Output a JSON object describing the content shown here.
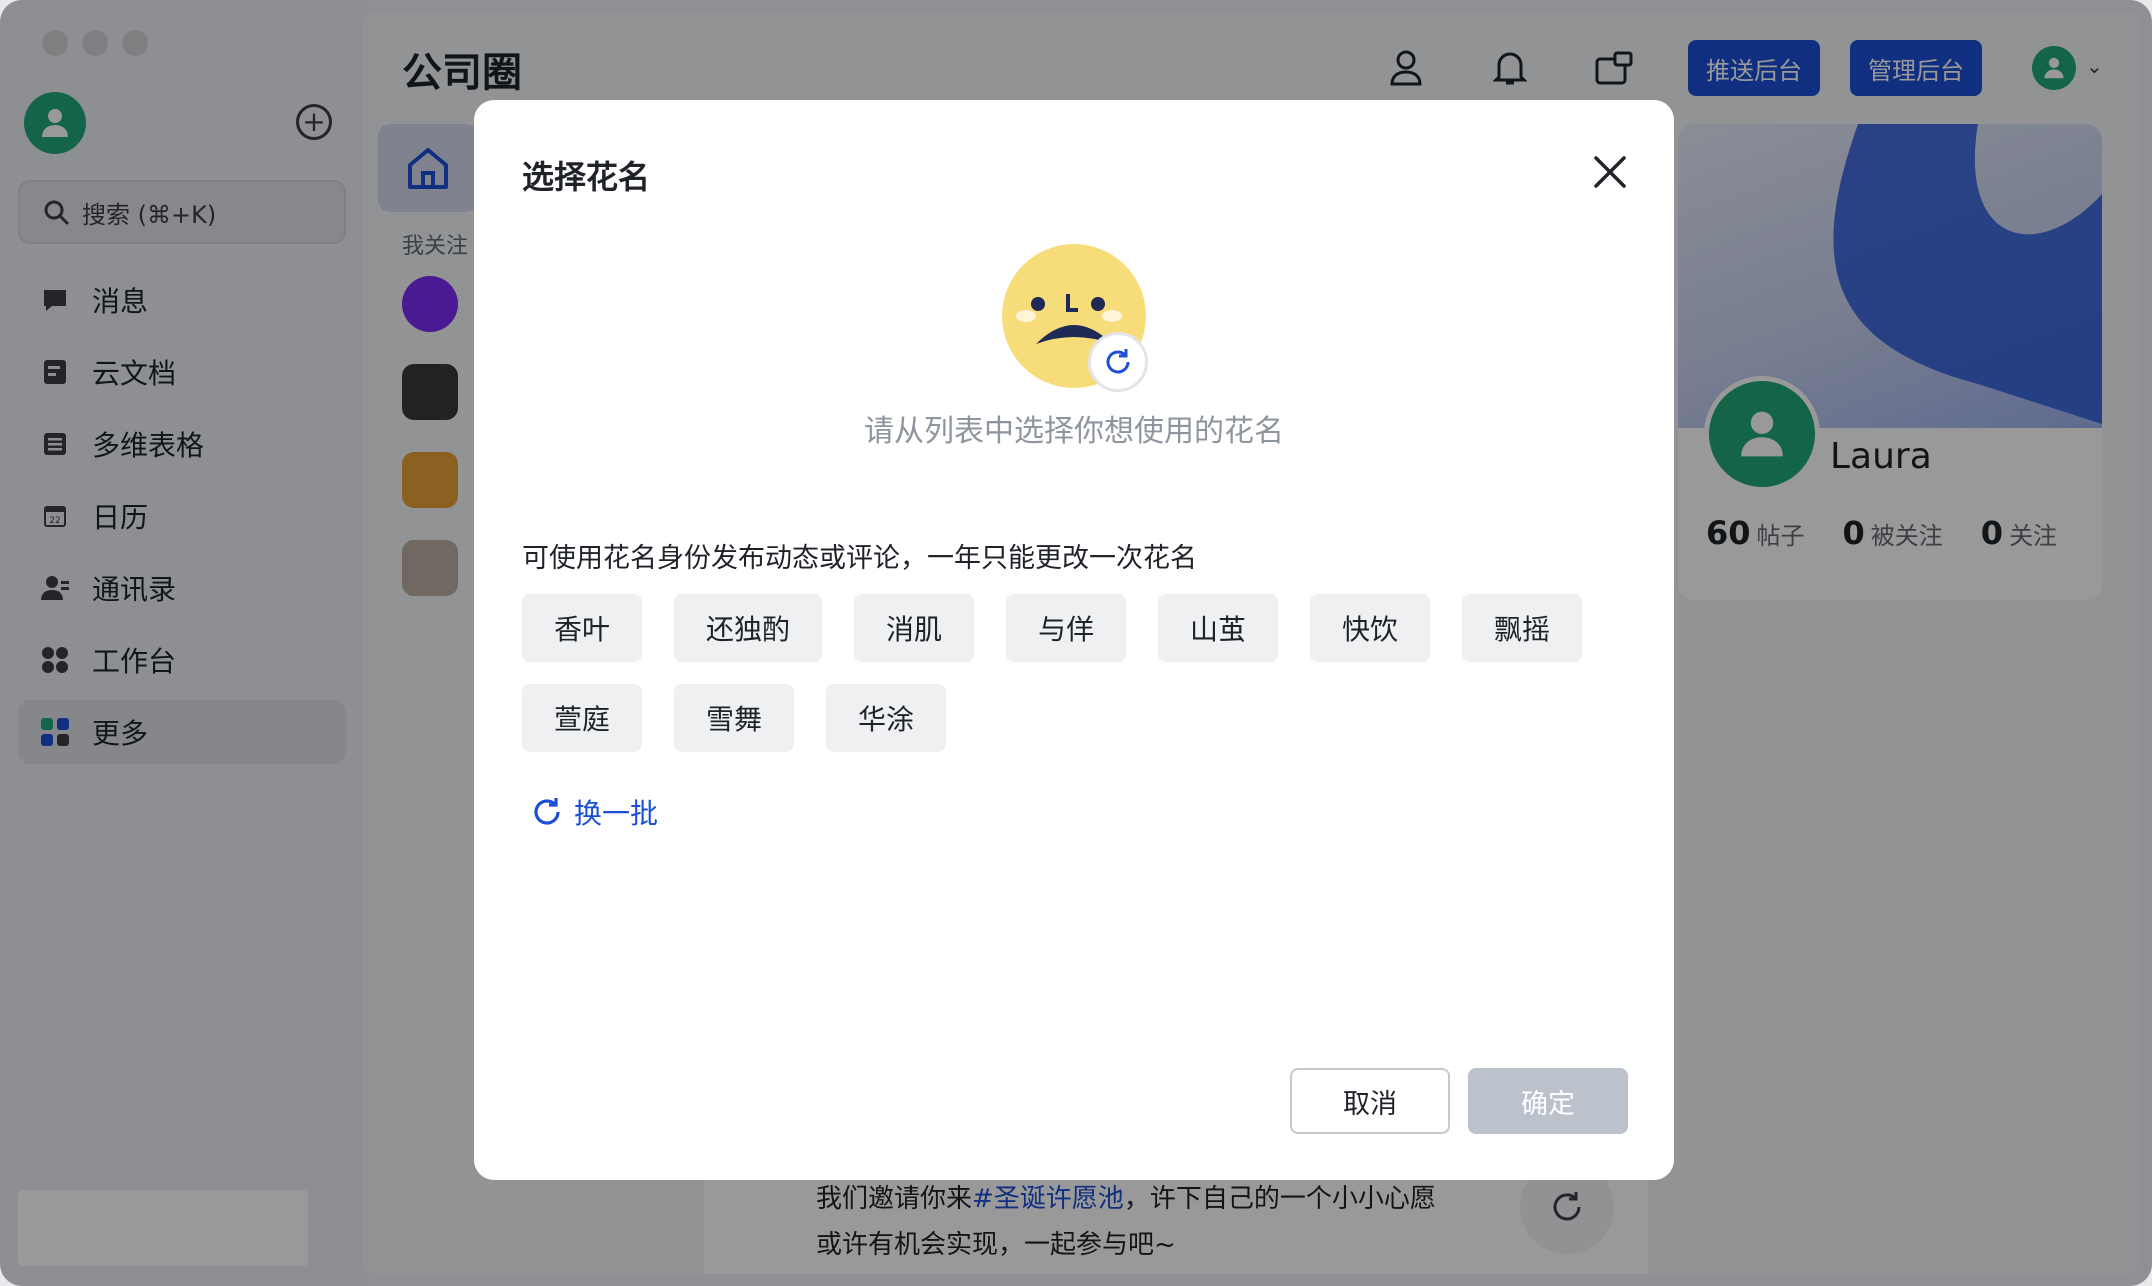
{
  "app": {
    "title": "公司圈"
  },
  "sidebar": {
    "search_label": "搜索 (⌘+K)",
    "items": [
      {
        "label": "消息",
        "icon": "message-icon"
      },
      {
        "label": "云文档",
        "icon": "docs-icon"
      },
      {
        "label": "多维表格",
        "icon": "base-icon"
      },
      {
        "label": "日历",
        "icon": "calendar-icon",
        "badge": "22"
      },
      {
        "label": "通讯录",
        "icon": "contacts-icon"
      },
      {
        "label": "工作台",
        "icon": "workplace-icon"
      },
      {
        "label": "更多",
        "icon": "more-apps-icon",
        "selected": true
      }
    ]
  },
  "header": {
    "push_admin": "推送后台",
    "manage_admin": "管理后台"
  },
  "feed": {
    "following_label": "我关注",
    "post_text_prefix": "我们邀请你来",
    "post_topic": "#圣诞许愿池",
    "post_text_suffix": "，许下自己的一个小小心愿",
    "post_text_line2": "或许有机会实现，一起参与吧~"
  },
  "profile": {
    "name": "Laura",
    "posts_count": "60",
    "posts_label": "帖子",
    "followers_count": "0",
    "followers_label": "被关注",
    "following_count": "0",
    "following_label": "关注"
  },
  "modal": {
    "title": "选择花名",
    "hint": "请从列表中选择你想使用的花名",
    "description": "可使用花名身份发布动态或评论，一年只能更改一次花名",
    "names": [
      "香叶",
      "还独酌",
      "消肌",
      "与佯",
      "山茧",
      "快饮",
      "飘摇",
      "萱庭",
      "雪舞",
      "华涂"
    ],
    "change_batch": "换一批",
    "cancel": "取消",
    "confirm": "确定"
  },
  "colors": {
    "accent": "#1c4fd6",
    "avatar_green": "#20a779"
  }
}
